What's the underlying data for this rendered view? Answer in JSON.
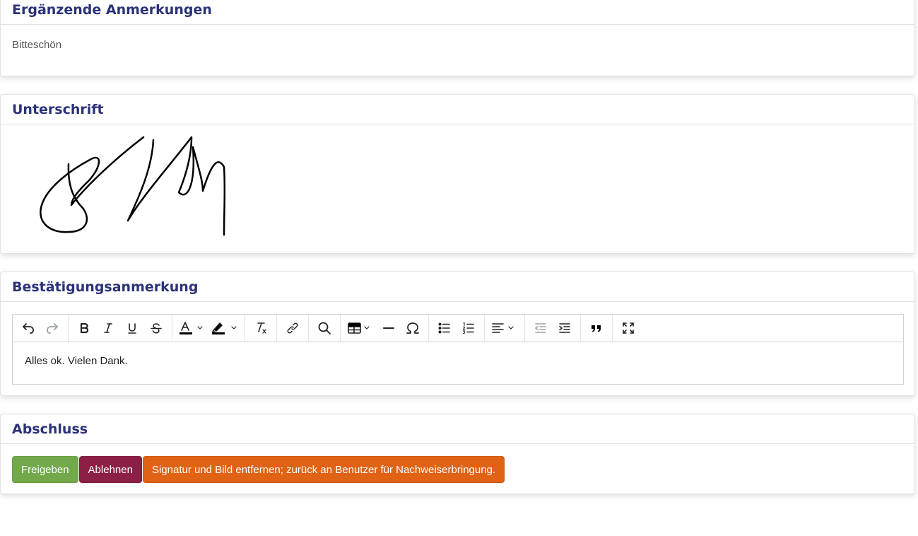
{
  "notes": {
    "title": "Ergänzende Anmerkungen",
    "text": "Bitteschön"
  },
  "signature": {
    "title": "Unterschrift"
  },
  "confirmation": {
    "title": "Bestätigungsanmerkung",
    "editor_text": "Alles ok. Vielen Dank.",
    "toolbar": [
      "undo-icon",
      "redo-icon",
      "bold-icon",
      "italic-icon",
      "underline-icon",
      "strikethrough-icon",
      "text-color-icon",
      "highlight-color-icon",
      "clear-formatting-icon",
      "link-icon",
      "find-icon",
      "table-icon",
      "horizontal-line-icon",
      "special-character-icon",
      "bullet-list-icon",
      "numbered-list-icon",
      "align-icon",
      "outdent-icon",
      "indent-icon",
      "blockquote-icon",
      "fullscreen-icon"
    ]
  },
  "finish": {
    "title": "Abschluss",
    "approve_label": "Freigeben",
    "reject_label": "Ablehnen",
    "remove_label": "Signatur und Bild entfernen; zurück an Benutzer für Nachweiserbringung."
  },
  "colors": {
    "title": "#2b3278",
    "approve": "#73a94a",
    "reject": "#8c1f45",
    "remove": "#e06215"
  }
}
